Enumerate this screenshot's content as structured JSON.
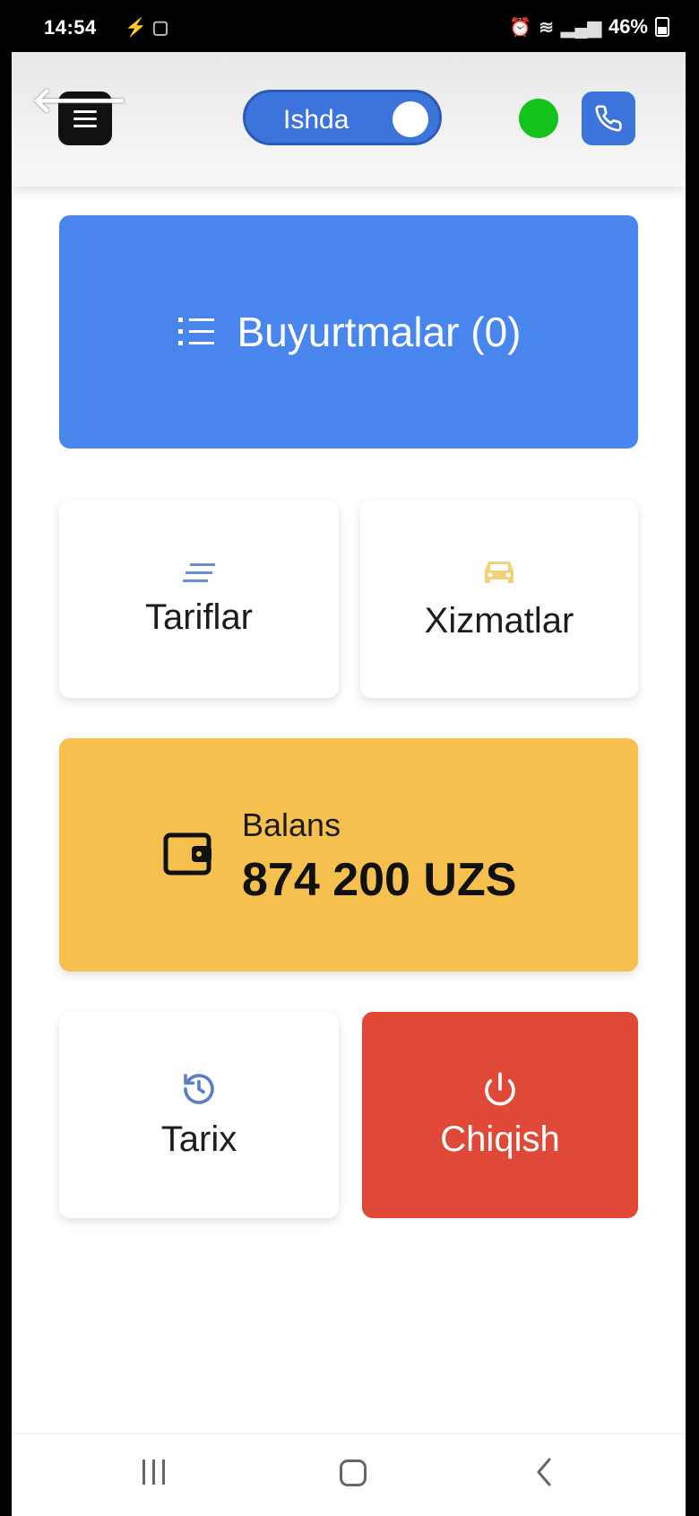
{
  "status_bar": {
    "time": "14:54",
    "battery_percent": "46%"
  },
  "header": {
    "status_toggle_label": "Ishda",
    "status_toggle_on": true,
    "online_indicator_color": "#14c21c"
  },
  "menu": {
    "orders_label": "Buyurtmalar (0)",
    "tariffs_label": "Tariflar",
    "services_label": "Xizmatlar",
    "history_label": "Tarix",
    "logout_label": "Chiqish"
  },
  "balance": {
    "label": "Balans",
    "value": "874 200 UZS"
  },
  "colors": {
    "primary_blue": "#4886ee",
    "balance_yellow": "#f5c04d",
    "logout_red": "#e04837"
  },
  "icons": {
    "back": "arrow-left-icon",
    "menu": "hamburger-icon",
    "phone": "phone-icon",
    "orders": "list-icon",
    "tariffs": "lines-icon",
    "services": "car-icon",
    "balance": "wallet-icon",
    "history": "history-icon",
    "logout": "power-icon"
  }
}
